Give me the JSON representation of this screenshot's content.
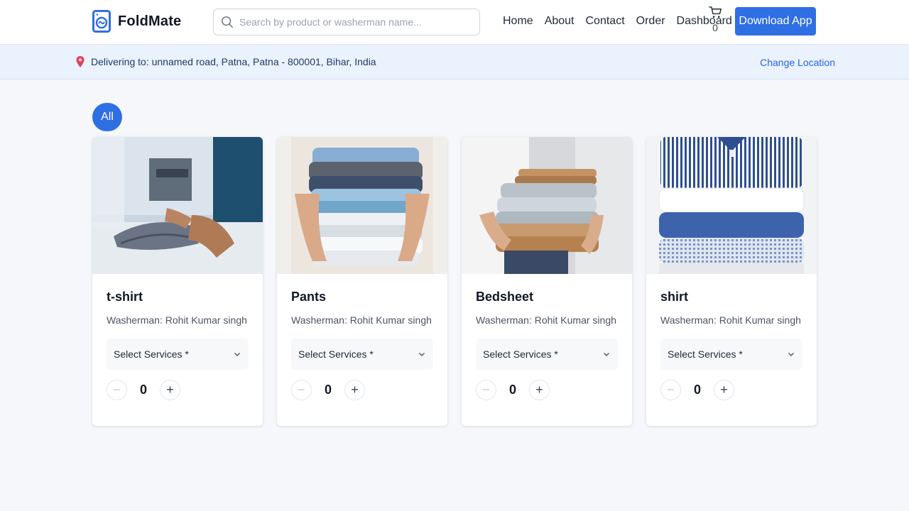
{
  "header": {
    "brand": "FoldMate",
    "search_placeholder": "Search by product or washerman name...",
    "nav": [
      "Home",
      "About",
      "Contact",
      "Order",
      "Dashboard"
    ],
    "cart_count": "0",
    "download_label": "Download App",
    "accent_color": "#2f6fe4"
  },
  "location": {
    "text": "Delivering to: unnamed road, Patna, Patna - 800001, Bihar, India",
    "change_label": "Change Location"
  },
  "filters": {
    "active": "All"
  },
  "products": [
    {
      "name": "t-shirt",
      "washerman": "Washerman: Rohit Kumar singh",
      "select_label": "Select Services *",
      "quantity": "0"
    },
    {
      "name": "Pants",
      "washerman": "Washerman: Rohit Kumar singh",
      "select_label": "Select Services *",
      "quantity": "0"
    },
    {
      "name": "Bedsheet",
      "washerman": "Washerman: Rohit Kumar singh",
      "select_label": "Select Services *",
      "quantity": "0"
    },
    {
      "name": "shirt",
      "washerman": "Washerman: Rohit Kumar singh",
      "select_label": "Select Services *",
      "quantity": "0"
    }
  ],
  "icons": {
    "logo": "washing-machine-icon",
    "search": "search-icon",
    "cart": "cart-icon",
    "location": "location-pin-icon",
    "dropdown": "chevron-down-icon",
    "minus": "minus-icon",
    "plus": "plus-icon"
  }
}
